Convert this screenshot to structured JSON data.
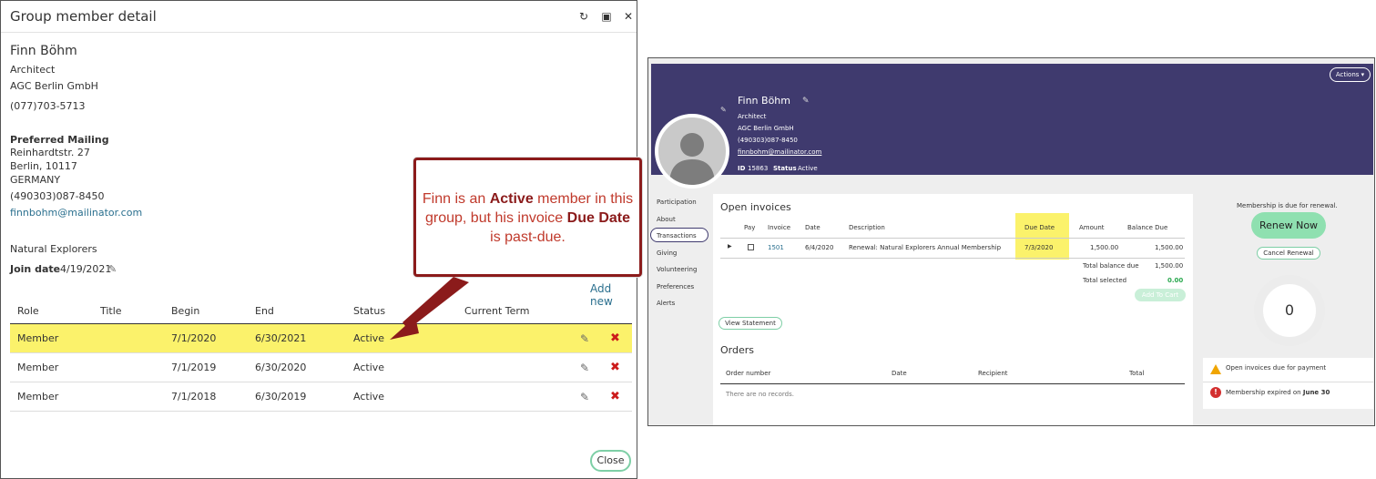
{
  "dialog": {
    "title": "Group member detail",
    "icons": [
      "refresh-icon",
      "maximize-icon",
      "close-icon"
    ],
    "name": "Finn Böhm",
    "job_title": "Architect",
    "company": "AGC Berlin GmbH",
    "phone": "(077)703-5713",
    "mailing_heading": "Preferred Mailing",
    "street": "Reinhardtstr. 27",
    "city": "Berlin, 10117",
    "country": "GERMANY",
    "mailing_phone": "(490303)087-8450",
    "email": "finnbohm@mailinator.com",
    "group_name": "Natural Explorers",
    "join_label": "Join date",
    "join_date": "4/19/2021",
    "add_new": "Add new",
    "columns": [
      "Role",
      "Title",
      "Begin",
      "End",
      "Status",
      "Current Term"
    ],
    "rows": [
      {
        "role": "Member",
        "title": "",
        "begin": "7/1/2020",
        "end": "6/30/2021",
        "status": "Active",
        "term": ""
      },
      {
        "role": "Member",
        "title": "",
        "begin": "7/1/2019",
        "end": "6/30/2020",
        "status": "Active",
        "term": ""
      },
      {
        "role": "Member",
        "title": "",
        "begin": "7/1/2018",
        "end": "6/30/2019",
        "status": "Active",
        "term": ""
      }
    ],
    "close_label": "Close"
  },
  "callout": {
    "t1": "Finn is an ",
    "b1": "Active",
    "t2": " member in this group, but his invoice ",
    "b2": "Due Date",
    "t3": " is past-due.",
    "colors": {
      "border": "#8b1b1b",
      "text": "#c0392b"
    }
  },
  "profile": {
    "actions_label": "Actions",
    "name": "Finn Böhm",
    "job_title": "Architect",
    "company": "AGC Berlin GmbH",
    "phone": "(490303)087-8450",
    "email": "finnbohm@mailinator.com",
    "id_label": "ID",
    "id_value": "15863",
    "status_label": "Status",
    "status_value": "Active",
    "nav": [
      "Participation",
      "About",
      "Transactions",
      "Giving",
      "Volunteering",
      "Preferences",
      "Alerts"
    ],
    "active_nav": "Transactions",
    "invoices_title": "Open invoices",
    "invoice_columns": [
      "Pay",
      "Invoice",
      "Date",
      "Description",
      "Due Date",
      "Amount",
      "Balance Due"
    ],
    "invoice_row": {
      "invoice": "1501",
      "date": "6/4/2020",
      "description": "Renewal: Natural Explorers Annual Membership",
      "due_date": "7/3/2020",
      "amount": "1,500.00",
      "balance": "1,500.00"
    },
    "total_balance_label": "Total balance due",
    "total_balance": "1,500.00",
    "total_selected_label": "Total selected",
    "total_selected": "0.00",
    "add_to_cart": "Add To Cart",
    "view_statement": "View Statement",
    "orders_title": "Orders",
    "order_columns": [
      "Order number",
      "Date",
      "Recipient",
      "Total"
    ],
    "no_records": "There are no records.",
    "renewal_note": "Membership is due for renewal.",
    "renew_now": "Renew Now",
    "cancel_renewal": "Cancel Renewal",
    "count": "0",
    "alert1": "Open invoices due for payment",
    "alert2_prefix": "Membership expired on ",
    "alert2_date": "June 30",
    "colors": {
      "banner": "#3f3a6e",
      "accent": "#8fe0b0",
      "highlight": "#fbf26b"
    }
  }
}
